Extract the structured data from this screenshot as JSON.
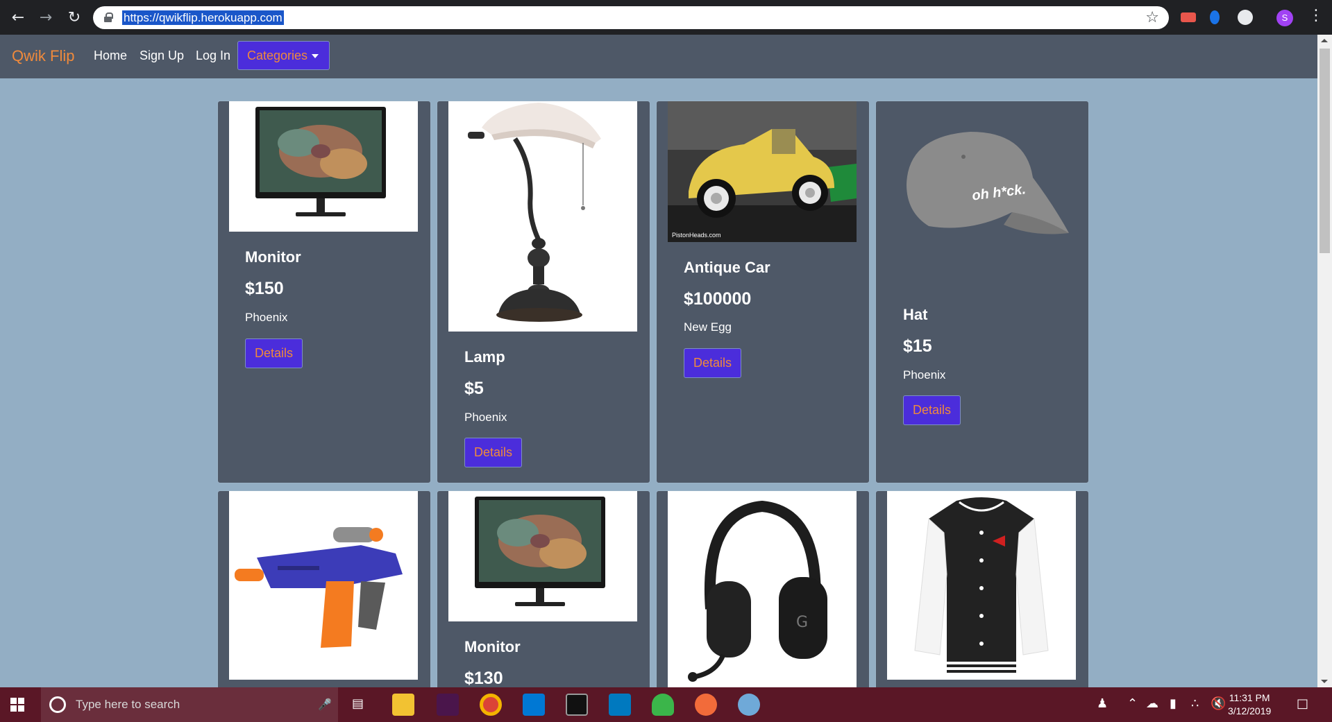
{
  "browser": {
    "url": "https://qwikflip.herokuapp.com",
    "back_icon": "arrow-left-icon",
    "forward_icon": "arrow-right-icon",
    "reload_icon": "reload-icon",
    "bookmark_icon": "star-icon",
    "profile_initial": "S"
  },
  "navbar": {
    "brand": "Qwik Flip",
    "links": [
      "Home",
      "Sign Up",
      "Log In"
    ],
    "categories_label": "Categories"
  },
  "colors": {
    "accent_orange": "#ef8a3c",
    "button_purple": "#4b2ddb",
    "card_bg": "#4e5867",
    "page_bg": "#93aec4"
  },
  "listings": [
    {
      "title": "Monitor",
      "price": "$150",
      "location": "Phoenix",
      "button": "Details",
      "image": "monitor"
    },
    {
      "title": "Lamp",
      "price": "$5",
      "location": "Phoenix",
      "button": "Details",
      "image": "lamp"
    },
    {
      "title": "Antique Car",
      "price": "$100000",
      "location": "New Egg",
      "button": "Details",
      "image": "antique-car"
    },
    {
      "title": "Hat",
      "price": "$15",
      "location": "Phoenix",
      "button": "Details",
      "image": "hat"
    },
    {
      "title": "",
      "price": "",
      "location": "",
      "button": "",
      "image": "toy-blaster"
    },
    {
      "title": "Monitor",
      "price": "$130",
      "location": "",
      "button": "",
      "image": "monitor"
    },
    {
      "title": "",
      "price": "",
      "location": "",
      "button": "",
      "image": "headset"
    },
    {
      "title": "",
      "price": "",
      "location": "",
      "button": "",
      "image": "jacket"
    }
  ],
  "hat_print": "oh h*ck.",
  "car_watermark": "PistonHeads.com",
  "taskbar": {
    "search_placeholder": "Type here to search",
    "time": "11:31 PM",
    "date": "3/12/2019"
  }
}
